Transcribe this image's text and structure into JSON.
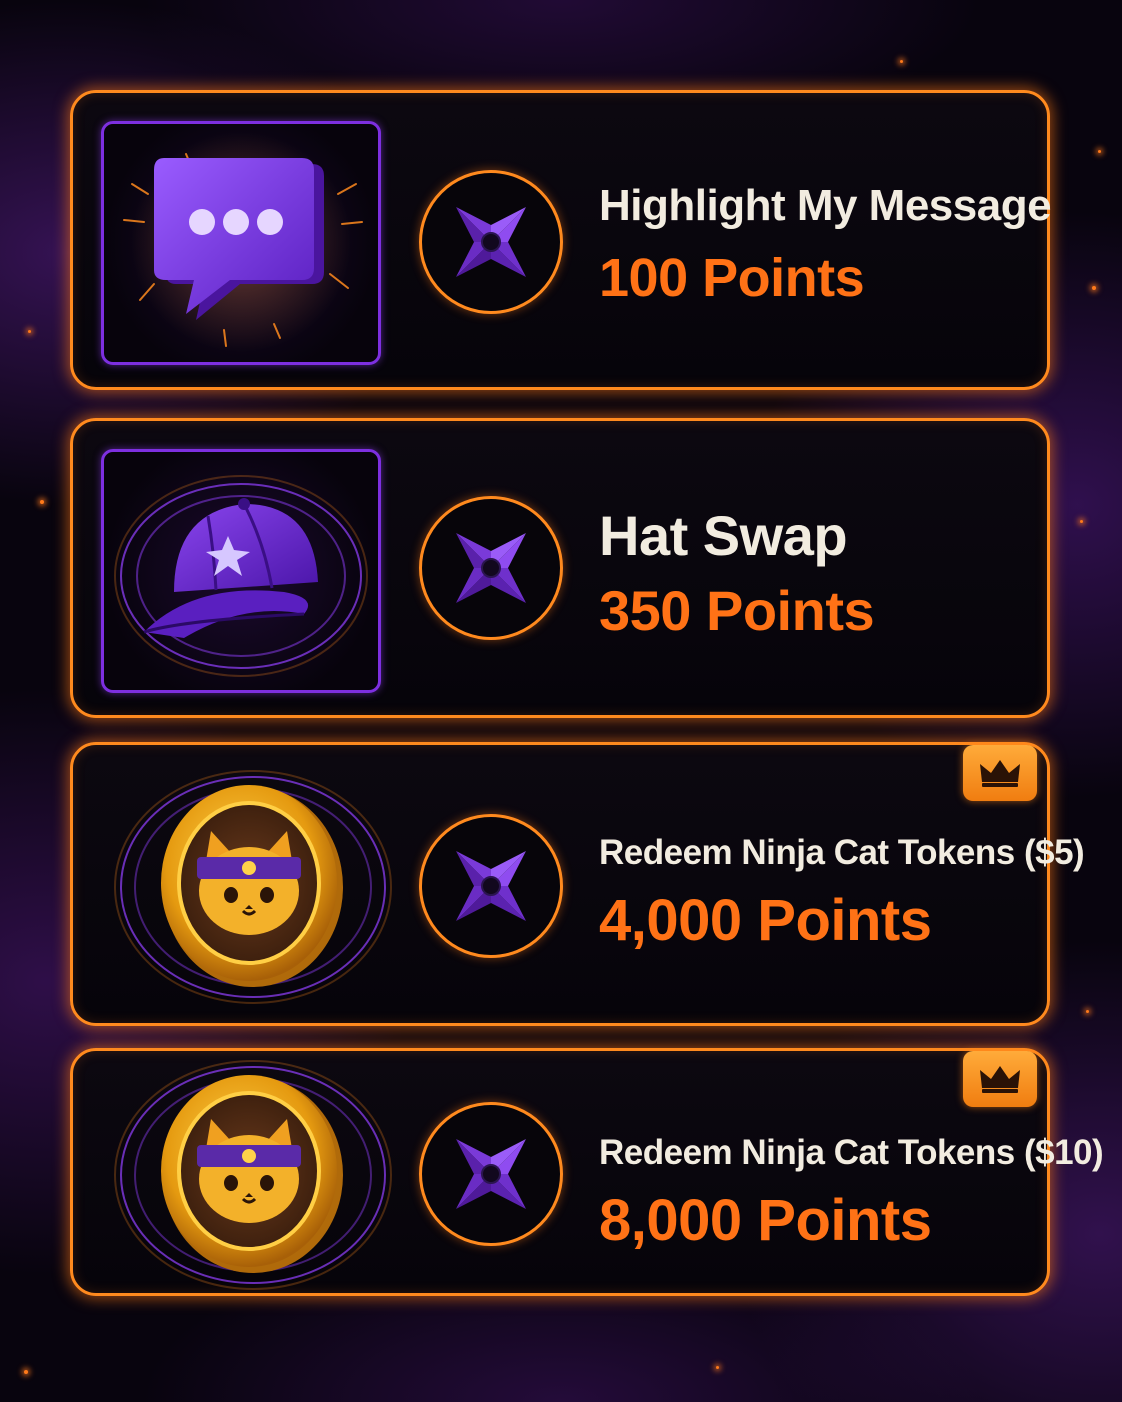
{
  "rewards": [
    {
      "title": "Highlight My Message",
      "points": "100 Points",
      "image_icon": "chat-bubble-icon",
      "badge_icon": "shuriken-icon",
      "premium": false
    },
    {
      "title": "Hat Swap",
      "points": "350 Points",
      "image_icon": "cap-icon",
      "badge_icon": "shuriken-icon",
      "premium": false
    },
    {
      "title": "Redeem Ninja Cat Tokens ($5)",
      "points": "4,000 Points",
      "image_icon": "ninja-cat-coin-icon",
      "badge_icon": "shuriken-icon",
      "premium": true,
      "premium_icon": "crown-icon"
    },
    {
      "title": "Redeem Ninja Cat Tokens ($10)",
      "points": "8,000 Points",
      "image_icon": "ninja-cat-coin-icon",
      "badge_icon": "shuriken-icon",
      "premium": true,
      "premium_icon": "crown-icon"
    }
  ],
  "colors": {
    "accent_orange": "#ff8a1e",
    "points_orange": "#ff7216",
    "purple": "#7d2fe0",
    "title_text": "#f2ece0",
    "background": "#08040e"
  }
}
